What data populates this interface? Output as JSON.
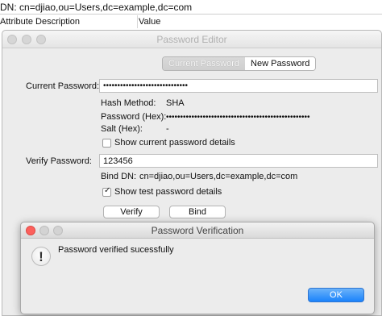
{
  "background_app": {
    "dn_label": "DN:",
    "dn_value": "cn=djiao,ou=Users,dc=example,dc=com",
    "columns": [
      "Attribute Description",
      "Value"
    ]
  },
  "editor": {
    "title": "Password Editor",
    "tabs": [
      {
        "label": "Current Password",
        "selected": false
      },
      {
        "label": "New Password",
        "selected": true
      }
    ],
    "current_password_label": "Current Password:",
    "current_password_value": "••••••••••••••••••••••••••••••",
    "hash_method_label": "Hash Method:",
    "hash_method_value": "SHA",
    "password_hex_label": "Password (Hex):",
    "password_hex_value": "•••••••••••••••••••••••••••••••••••••••••••••••••••",
    "salt_hex_label": "Salt (Hex):",
    "salt_hex_value": "-",
    "show_current_details": {
      "label": "Show current password details",
      "checked": false
    },
    "verify_password_label": "Verify Password:",
    "verify_password_value": "123456",
    "bind_dn_label": "Bind DN:",
    "bind_dn_value": "cn=djiao,ou=Users,dc=example,dc=com",
    "show_test_details": {
      "label": "Show test password details",
      "checked": true
    },
    "verify_button": "Verify",
    "bind_button": "Bind"
  },
  "dialog": {
    "title": "Password Verification",
    "icon": "alert-icon",
    "message": "Password verified sucessfully",
    "ok_button": "OK"
  },
  "colors": {
    "window_bg": "#ececec",
    "ok_button": "#1a82fb",
    "traffic_red": "#fc605c",
    "traffic_yellow": "#fdbc40",
    "traffic_green": "#34c84a"
  }
}
